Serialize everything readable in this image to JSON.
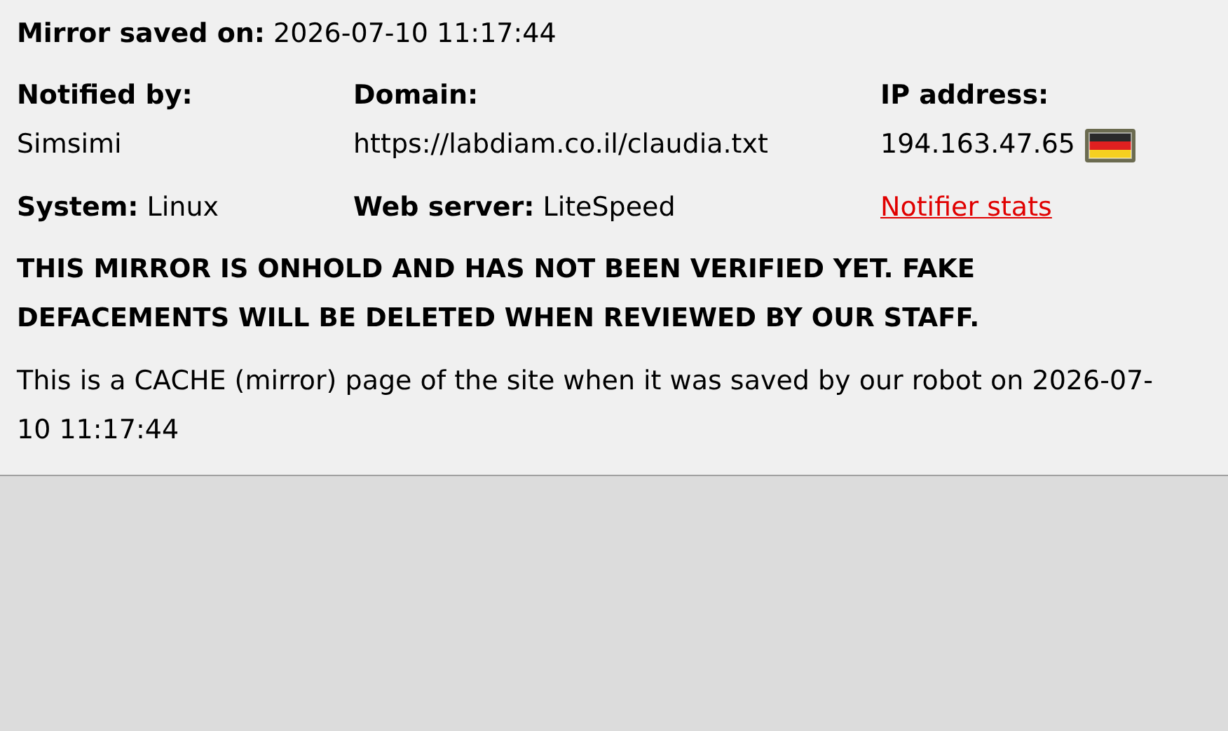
{
  "saved_on": {
    "label": "Mirror saved on:",
    "value": "2026-07-10 11:17:44"
  },
  "notified_by": {
    "label": "Notified by:",
    "value": "Simsimi"
  },
  "domain": {
    "label": "Domain:",
    "value": "https://labdiam.co.il/claudia.txt"
  },
  "ip_address": {
    "label": "IP address:",
    "value": "194.163.47.65"
  },
  "system": {
    "label": "System:",
    "value": "Linux"
  },
  "web_server": {
    "label": "Web server:",
    "value": "LiteSpeed"
  },
  "notifier_stats_link": "Notifier stats",
  "warning": "THIS MIRROR IS ONHOLD AND HAS NOT BEEN VERIFIED YET. FAKE DEFACEMENTS WILL BE DELETED WHEN REVIEWED BY OUR STAFF.",
  "note": "This is a CACHE (mirror) page of the site when it was saved by our robot on 2026-07-10 11:17:44"
}
